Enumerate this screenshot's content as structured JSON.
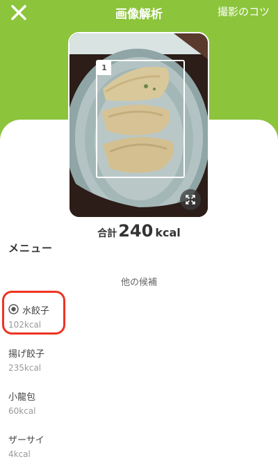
{
  "header": {
    "title": "画像解析",
    "tips_link": "撮影のコツ",
    "close_icon": "close-icon"
  },
  "photo": {
    "detections": [
      {
        "number": "1"
      }
    ],
    "expand_icon": "expand-icon"
  },
  "total": {
    "label": "合計",
    "value": "240",
    "unit": "kcal"
  },
  "menu": {
    "heading": "メニュー",
    "other_candidates": "他の候補",
    "items": [
      {
        "name": "水餃子",
        "kcal": "102kcal",
        "selected": true
      },
      {
        "name": "揚げ餃子",
        "kcal": "235kcal",
        "selected": false
      },
      {
        "name": "小龍包",
        "kcal": "60kcal",
        "selected": false
      },
      {
        "name": "ザーサイ",
        "kcal": "4kcal",
        "selected": false
      }
    ]
  },
  "colors": {
    "brand_green": "#8cc43c",
    "highlight_red": "#ee3322"
  }
}
